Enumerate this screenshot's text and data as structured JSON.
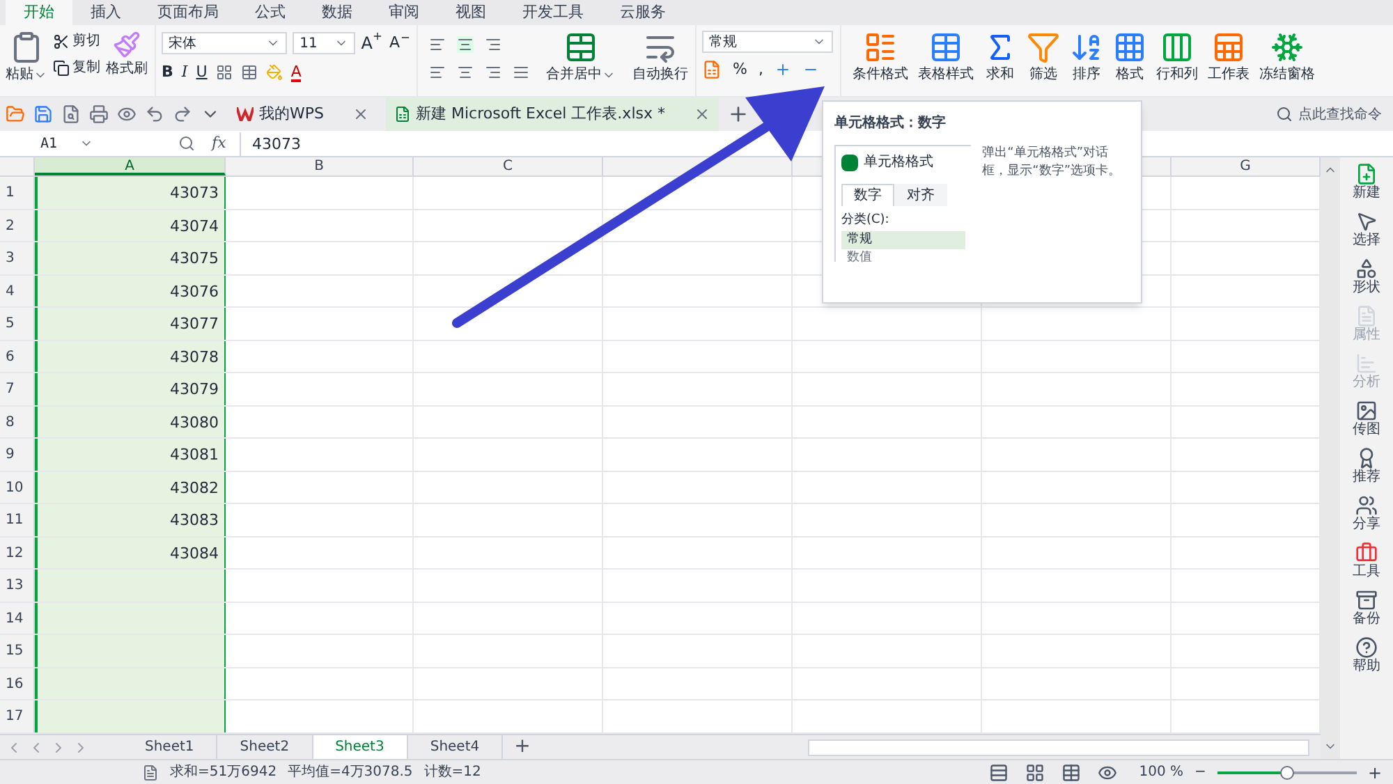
{
  "menu_tabs": [
    {
      "label": "开始",
      "selected": true
    },
    {
      "label": "插入",
      "selected": false
    },
    {
      "label": "页面布局",
      "selected": false
    },
    {
      "label": "公式",
      "selected": false
    },
    {
      "label": "数据",
      "selected": false
    },
    {
      "label": "审阅",
      "selected": false
    },
    {
      "label": "视图",
      "selected": false
    },
    {
      "label": "开发工具",
      "selected": false
    },
    {
      "label": "云服务",
      "selected": false
    }
  ],
  "ribbon": {
    "paste": "粘贴",
    "cut": "剪切",
    "copy": "复制",
    "format_painter": "格式刷",
    "font_name": "宋体",
    "font_size": "11",
    "bold": "B",
    "italic": "I",
    "underline": "U",
    "font_color": "A",
    "merge": "合并居中",
    "wrap": "自动换行",
    "number_format": "常规",
    "percent": "%",
    "comma": ",",
    "grow_font": "A",
    "shrink_font": "A",
    "tools": [
      {
        "label": "条件格式"
      },
      {
        "label": "表格样式"
      },
      {
        "label": "求和"
      },
      {
        "label": "筛选"
      },
      {
        "label": "排序"
      },
      {
        "label": "格式"
      },
      {
        "label": "行和列"
      },
      {
        "label": "工作表"
      },
      {
        "label": "冻结窗格"
      }
    ]
  },
  "doc_tabs": [
    {
      "label": "我的WPS",
      "selected": false
    },
    {
      "label": "新建 Microsoft Excel 工作表.xlsx *",
      "selected": true
    }
  ],
  "command_search": {
    "placeholder": "点此查找命令"
  },
  "formula_bar": {
    "name_box": "A1",
    "fx": "fx",
    "value": "43073"
  },
  "columns": [
    {
      "label": "A",
      "selected": true
    },
    {
      "label": "B",
      "selected": false
    },
    {
      "label": "C",
      "selected": false
    },
    {
      "label": "G",
      "selected": false
    }
  ],
  "rows": [
    {
      "number": "1",
      "a": "43073"
    },
    {
      "number": "2",
      "a": "43074"
    },
    {
      "number": "3",
      "a": "43075"
    },
    {
      "number": "4",
      "a": "43076"
    },
    {
      "number": "5",
      "a": "43077"
    },
    {
      "number": "6",
      "a": "43078"
    },
    {
      "number": "7",
      "a": "43079"
    },
    {
      "number": "8",
      "a": "43080"
    },
    {
      "number": "9",
      "a": "43081"
    },
    {
      "number": "10",
      "a": "43082"
    },
    {
      "number": "11",
      "a": "43083"
    },
    {
      "number": "12",
      "a": "43084"
    },
    {
      "number": "13"
    },
    {
      "number": "14"
    },
    {
      "number": "15"
    },
    {
      "number": "16"
    },
    {
      "number": "17"
    }
  ],
  "tooltip": {
    "title": "单元格格式：数字",
    "preview_title": "单元格格式",
    "preview_tabs": [
      {
        "label": "数字",
        "selected": true
      },
      {
        "label": "对齐",
        "selected": false
      }
    ],
    "category_label": "分类(C):",
    "categories": [
      {
        "label": "常规",
        "selected": true
      },
      {
        "label": "数值",
        "selected": false
      }
    ],
    "description": "弹出“单元格格式”对话框，显示“数字”选项卡。"
  },
  "sidebar": [
    {
      "label": "新建",
      "disabled": false
    },
    {
      "label": "选择",
      "disabled": false
    },
    {
      "label": "形状",
      "disabled": false
    },
    {
      "label": "属性",
      "disabled": true
    },
    {
      "label": "分析",
      "disabled": true
    },
    {
      "label": "传图",
      "disabled": false
    },
    {
      "label": "推荐",
      "disabled": false
    },
    {
      "label": "分享",
      "disabled": false
    },
    {
      "label": "工具",
      "disabled": false
    },
    {
      "label": "备份",
      "disabled": false
    },
    {
      "label": "帮助",
      "disabled": false
    }
  ],
  "sheet_tabs": [
    {
      "label": "Sheet1",
      "selected": false
    },
    {
      "label": "Sheet2",
      "selected": false
    },
    {
      "label": "Sheet3",
      "selected": true
    },
    {
      "label": "Sheet4",
      "selected": false
    }
  ],
  "add_sheet": "+",
  "status_bar": {
    "sum": "求和=51万6942",
    "average": "平均值=4万3078.5",
    "count": "计数=12",
    "zoom": "100 %",
    "zoom_slider": {
      "level": 0.5
    },
    "zoom_out": "−",
    "zoom_in": "+"
  }
}
